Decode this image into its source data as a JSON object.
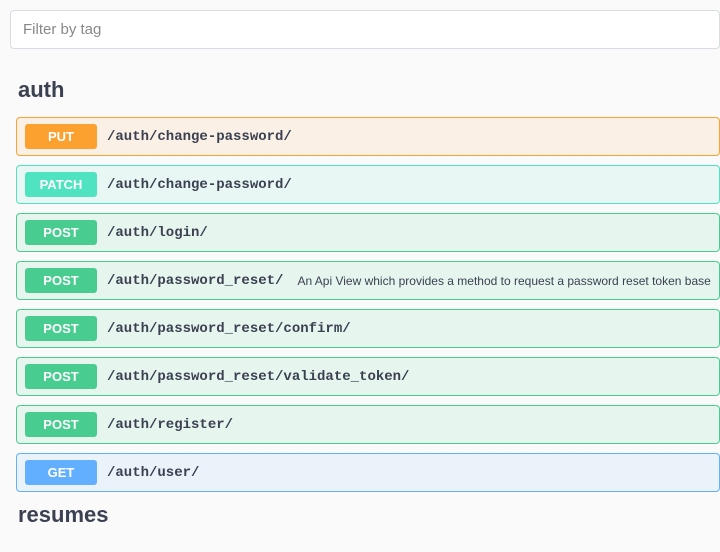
{
  "filter": {
    "placeholder": "Filter by tag"
  },
  "sections": [
    {
      "title": "auth",
      "endpoints": [
        {
          "method": "PUT",
          "cls": "ep-put",
          "path": "/auth/change-password/",
          "desc": ""
        },
        {
          "method": "PATCH",
          "cls": "ep-patch",
          "path": "/auth/change-password/",
          "desc": ""
        },
        {
          "method": "POST",
          "cls": "ep-post",
          "path": "/auth/login/",
          "desc": ""
        },
        {
          "method": "POST",
          "cls": "ep-post",
          "path": "/auth/password_reset/",
          "desc": "An Api View which provides a method to request a password reset token based on an e-ma"
        },
        {
          "method": "POST",
          "cls": "ep-post",
          "path": "/auth/password_reset/confirm/",
          "desc": ""
        },
        {
          "method": "POST",
          "cls": "ep-post",
          "path": "/auth/password_reset/validate_token/",
          "desc": ""
        },
        {
          "method": "POST",
          "cls": "ep-post",
          "path": "/auth/register/",
          "desc": ""
        },
        {
          "method": "GET",
          "cls": "ep-get",
          "path": "/auth/user/",
          "desc": ""
        }
      ]
    },
    {
      "title": "resumes",
      "endpoints": []
    }
  ]
}
